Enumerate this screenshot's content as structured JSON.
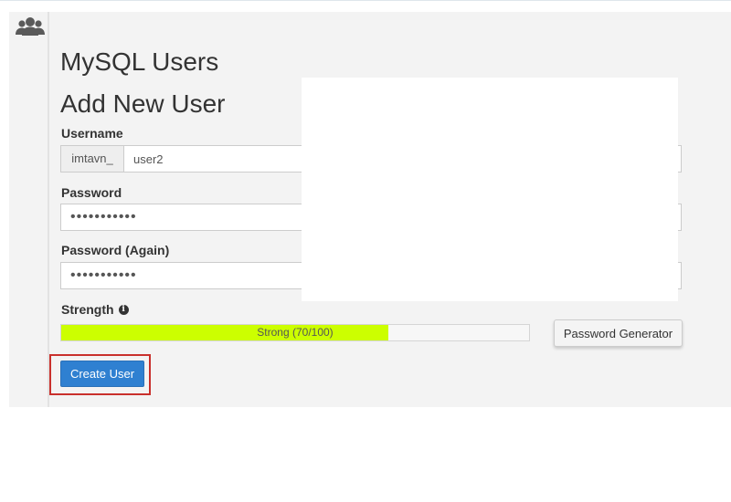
{
  "page": {
    "title": "MySQL Users",
    "section_title": "Add New User",
    "sidebar_icon": "users-icon"
  },
  "form": {
    "username": {
      "label": "Username",
      "prefix": "imtavn_",
      "value": "user2"
    },
    "password": {
      "label": "Password",
      "value": "•••••••••••"
    },
    "password_again": {
      "label": "Password (Again)",
      "value": "•••••••••••"
    },
    "strength": {
      "label": "Strength",
      "info_icon": "info-icon",
      "text": "Strong (70/100)",
      "score": 70,
      "max": 100,
      "fill_fraction": 0.7,
      "bar_color": "#ccff00"
    },
    "generator_label": "Password Generator",
    "create_label": "Create User"
  },
  "colors": {
    "primary_button": "#2f80d1",
    "highlight_border": "#c9302c",
    "panel_background": "#f3f3f3"
  }
}
